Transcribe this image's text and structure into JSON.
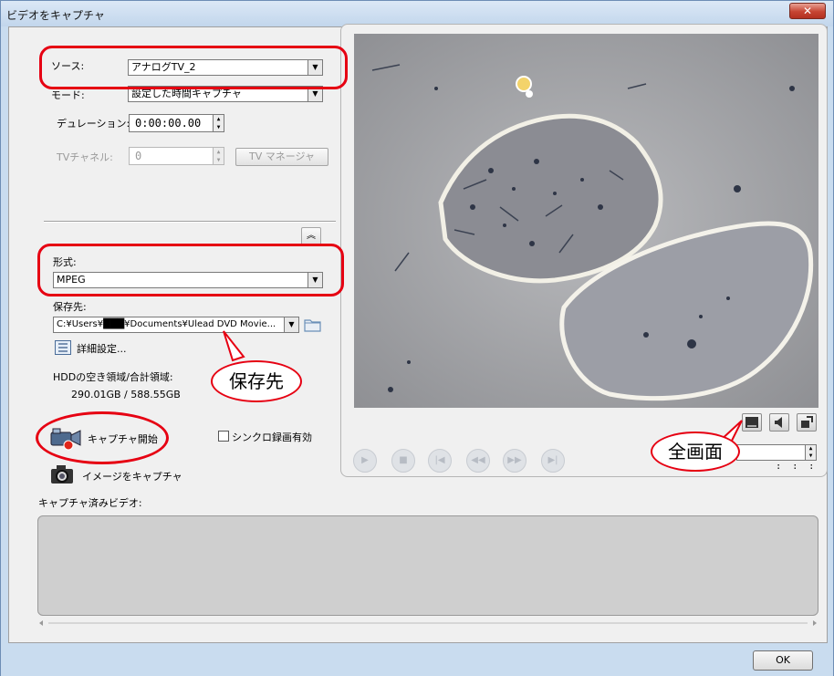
{
  "window": {
    "title": "ビデオをキャプチャ"
  },
  "settings": {
    "source_label": "ソース:",
    "source_value": "アナログTV_2",
    "mode_label": "モード:",
    "mode_value": "設定した時間キャプチャ",
    "duration_label": "デュレーション:",
    "duration_value": "0:00:00.00",
    "tv_channel_label": "TVチャネル:",
    "tv_channel_value": "0",
    "tv_manager_label": "TV マネージャ"
  },
  "format": {
    "label": "形式:",
    "value": "MPEG",
    "save_to_label": "保存先:",
    "save_to_value": "C:¥Users¥███¥Documents¥Ulead DVD Movie...",
    "advanced_label": "詳細設定..."
  },
  "disk": {
    "label": "HDDの空き領域/合計領域:",
    "value": "290.01GB / 588.55GB"
  },
  "capture": {
    "start_label": "キャプチャ開始",
    "image_label": "イメージをキャプチャ",
    "sync_label": "シンクロ録画有効",
    "captured_label": "キャプチャ済みビデオ:"
  },
  "playback": {
    "timecode": "  :  :  :  "
  },
  "annotations": {
    "save_callout": "保存先",
    "fullscreen_callout": "全画面"
  },
  "footer": {
    "ok_label": "OK"
  },
  "colors": {
    "annotation_red": "#e60012",
    "title_bar": "#c9dcef"
  }
}
